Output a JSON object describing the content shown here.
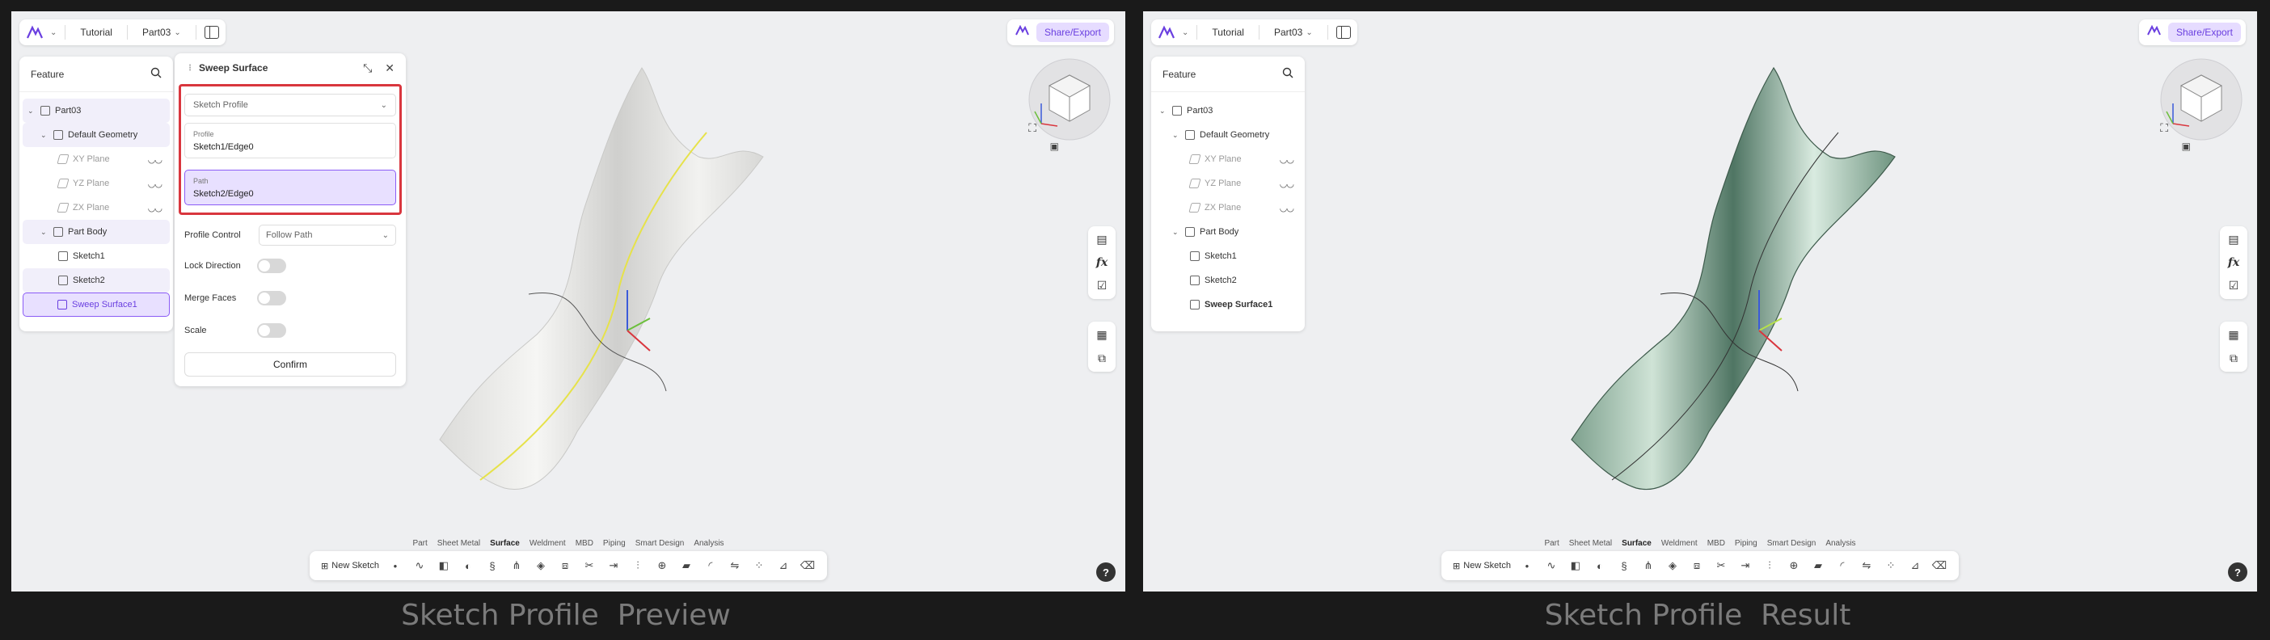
{
  "topbar": {
    "tutorial": "Tutorial",
    "part": "Part03"
  },
  "share_label": "Share/Export",
  "tree": {
    "title": "Feature",
    "items": [
      {
        "label": "Part03"
      },
      {
        "label": "Default Geometry"
      },
      {
        "label": "XY Plane"
      },
      {
        "label": "YZ Plane"
      },
      {
        "label": "ZX Plane"
      },
      {
        "label": "Part Body"
      },
      {
        "label": "Sketch1"
      },
      {
        "label": "Sketch2"
      },
      {
        "label": "Sweep Surface1"
      }
    ]
  },
  "sweep": {
    "title": "Sweep Surface",
    "mode": "Sketch Profile",
    "profile_label": "Profile",
    "profile_value": "Sketch1/Edge0",
    "path_label": "Path",
    "path_value": "Sketch2/Edge0",
    "profile_control_label": "Profile Control",
    "profile_control_value": "Follow Path",
    "lock_direction": "Lock Direction",
    "merge_faces": "Merge Faces",
    "scale": "Scale",
    "confirm": "Confirm"
  },
  "tabs": [
    "Part",
    "Sheet Metal",
    "Surface",
    "Weldment",
    "MBD",
    "Piping",
    "Smart Design",
    "Analysis"
  ],
  "toolbar": {
    "new_sketch": "New Sketch"
  },
  "captions": {
    "left": "Sketch Profile  Preview",
    "right": "Sketch Profile  Result"
  },
  "colors": {
    "accent": "#8b5cf6",
    "highlight": "#d9363e",
    "surface_result": "#8fb5a0"
  }
}
